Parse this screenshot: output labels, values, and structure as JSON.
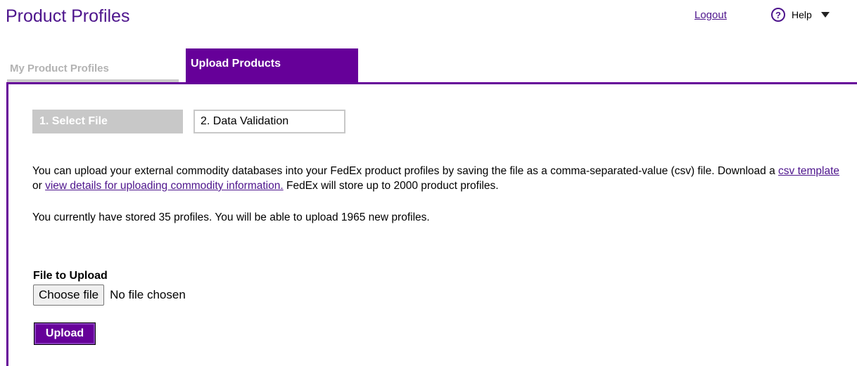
{
  "header": {
    "title": "Product Profiles",
    "logout_label": "Logout",
    "help_icon_glyph": "?",
    "help_label": "Help"
  },
  "tabs": [
    {
      "label": "My Product Profiles",
      "active": false
    },
    {
      "label": "Upload Products",
      "active": true
    }
  ],
  "steps": [
    {
      "label": "1. Select File",
      "active": false
    },
    {
      "label": "2. Data Validation",
      "active": true
    }
  ],
  "intro": {
    "text_before": "You can upload your external commodity databases into your FedEx product profiles by saving the file as a comma-separated-value (csv) file. Download a ",
    "link_template": "csv template",
    "text_or": " or ",
    "link_details": "view details for uploading commodity information.",
    "text_after": " FedEx will store up to 2000 product profiles."
  },
  "status_text": "You currently have stored 35 profiles. You will be able to upload 1965 new profiles.",
  "upload_form": {
    "file_label": "File to Upload",
    "choose_file_label": "Choose file",
    "no_file_text": "No file chosen",
    "upload_label": "Upload"
  },
  "colors": {
    "brand_purple": "#660099",
    "link_purple": "#4d148c",
    "inactive_gray": "#c8c8c8"
  }
}
